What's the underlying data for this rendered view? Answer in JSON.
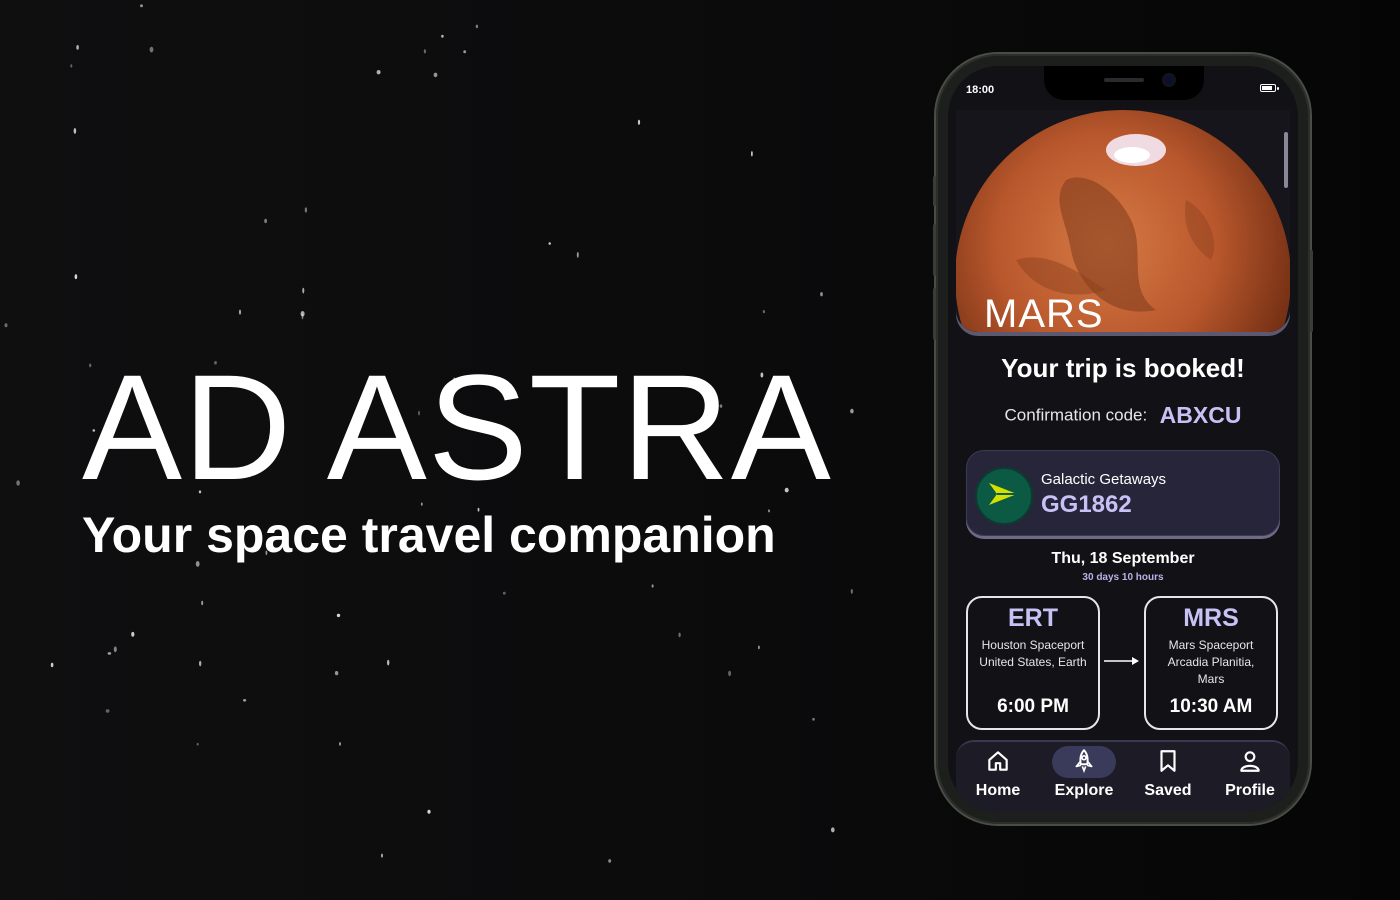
{
  "hero": {
    "title": "AD ASTRA",
    "subtitle": "Your space travel companion"
  },
  "phone": {
    "status_time": "18:00",
    "destination": "MARS",
    "booking_title": "Your trip is booked!",
    "confirmation_label": "Confirmation code:",
    "confirmation_code": "ABXCU",
    "airline": "Galactic Getaways",
    "flight_number": "GG1862",
    "date": "Thu, 18 September",
    "countdown": "30 days 10 hours",
    "departure": {
      "code": "ERT",
      "place_line1": "Houston Spaceport",
      "place_line2": "United States, Earth",
      "time": "6:00 PM"
    },
    "arrival": {
      "code": "MRS",
      "place_line1": "Mars Spaceport",
      "place_line2": "Arcadia Planitia,",
      "place_line3": "Mars",
      "time": "10:30 AM"
    },
    "nav": [
      {
        "label": "Home",
        "icon": "home-icon",
        "active": false
      },
      {
        "label": "Explore",
        "icon": "rocket-icon",
        "active": true
      },
      {
        "label": "Saved",
        "icon": "bookmark-icon",
        "active": false
      },
      {
        "label": "Profile",
        "icon": "person-icon",
        "active": false
      }
    ]
  },
  "colors": {
    "accent": "#c8c1f5",
    "screen_bg": "#121216",
    "card_bg": "#26253a",
    "airline_logo": "#0d5a44",
    "airline_arrow": "#d4e000",
    "mars_orange": "#b8572c"
  }
}
